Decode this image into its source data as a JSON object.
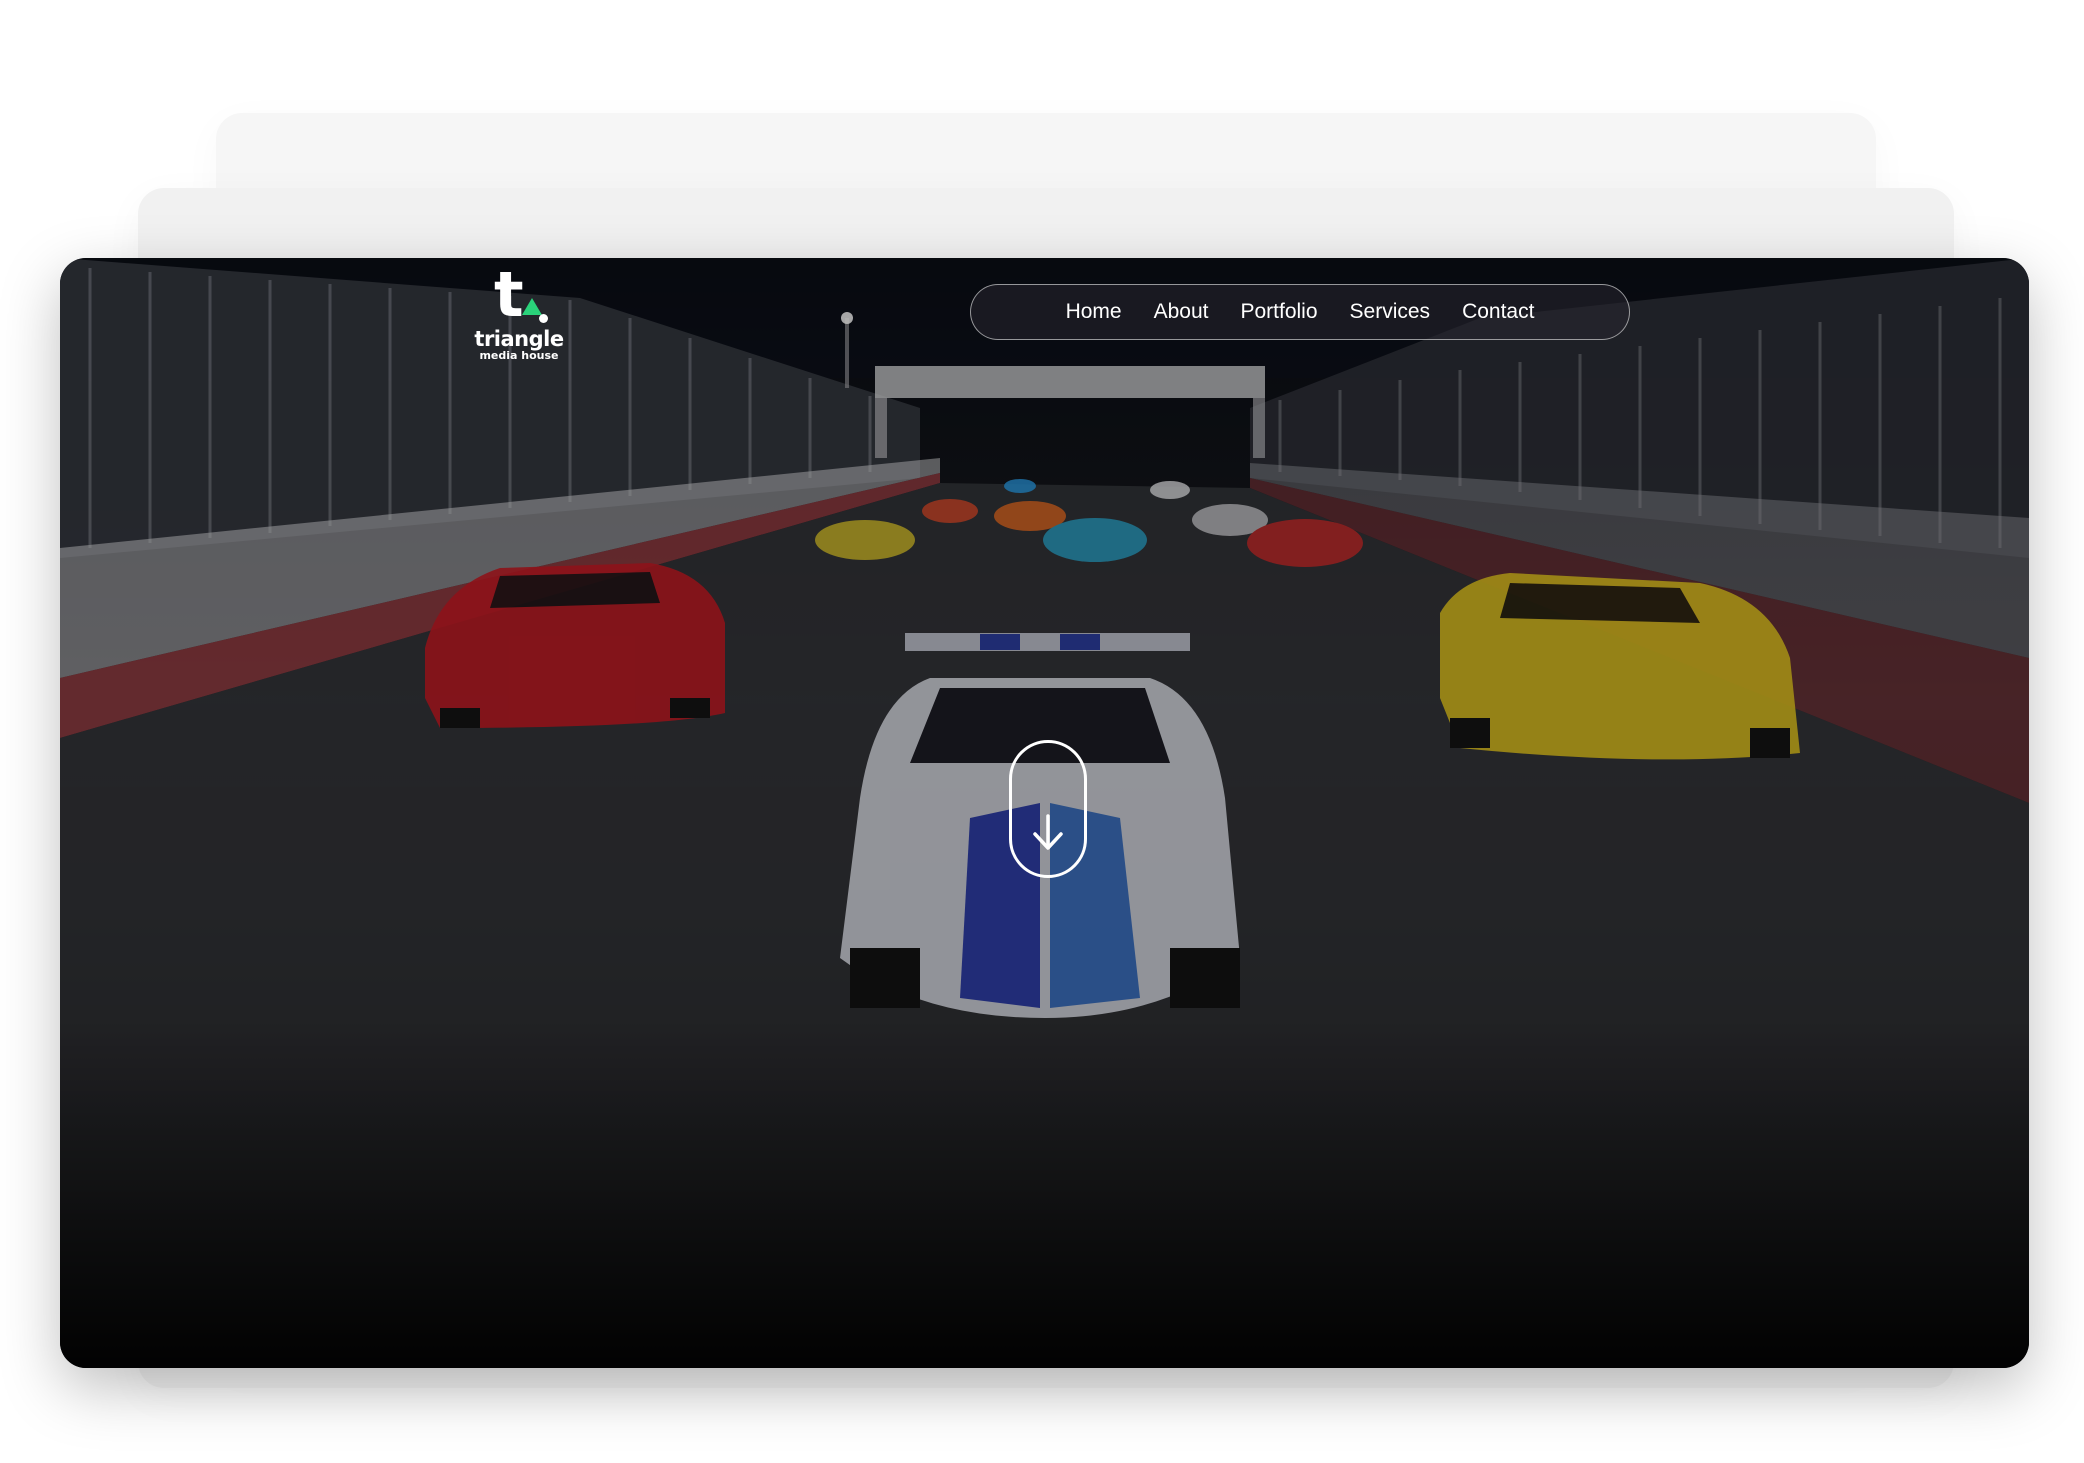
{
  "brand": {
    "logo_mark": "t.",
    "name": "triangle",
    "tagline": "media house",
    "accent_color": "#2ad27a"
  },
  "nav": {
    "items": [
      {
        "label": "Home"
      },
      {
        "label": "About"
      },
      {
        "label": "Portfolio"
      },
      {
        "label": "Services"
      },
      {
        "label": "Contact"
      }
    ]
  },
  "hero": {
    "scroll_icon": "arrow-down-icon",
    "overlay_color": "#000000"
  }
}
